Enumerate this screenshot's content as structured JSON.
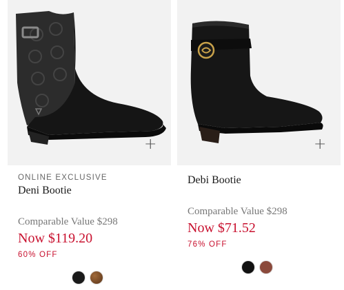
{
  "products": [
    {
      "eyebrow": "ONLINE EXCLUSIVE",
      "name": "Deni Bootie",
      "comparable": "Comparable Value $298",
      "now": "Now $119.20",
      "off": "60% OFF",
      "swatches": [
        {
          "name": "black",
          "color": "#1a1a1a"
        },
        {
          "name": "brown",
          "color": "#7a4a24"
        }
      ],
      "image_icon": "plus-icon"
    },
    {
      "name": "Debi Bootie",
      "comparable": "Comparable Value $298",
      "now": "Now $71.52",
      "off": "76% OFF",
      "swatches": [
        {
          "name": "black",
          "color": "#111111"
        },
        {
          "name": "saddle",
          "color": "#8b4a3c"
        }
      ],
      "image_icon": "plus-icon"
    }
  ],
  "colors": {
    "sale_red": "#c8102e",
    "image_background": "#f2f2f2"
  }
}
